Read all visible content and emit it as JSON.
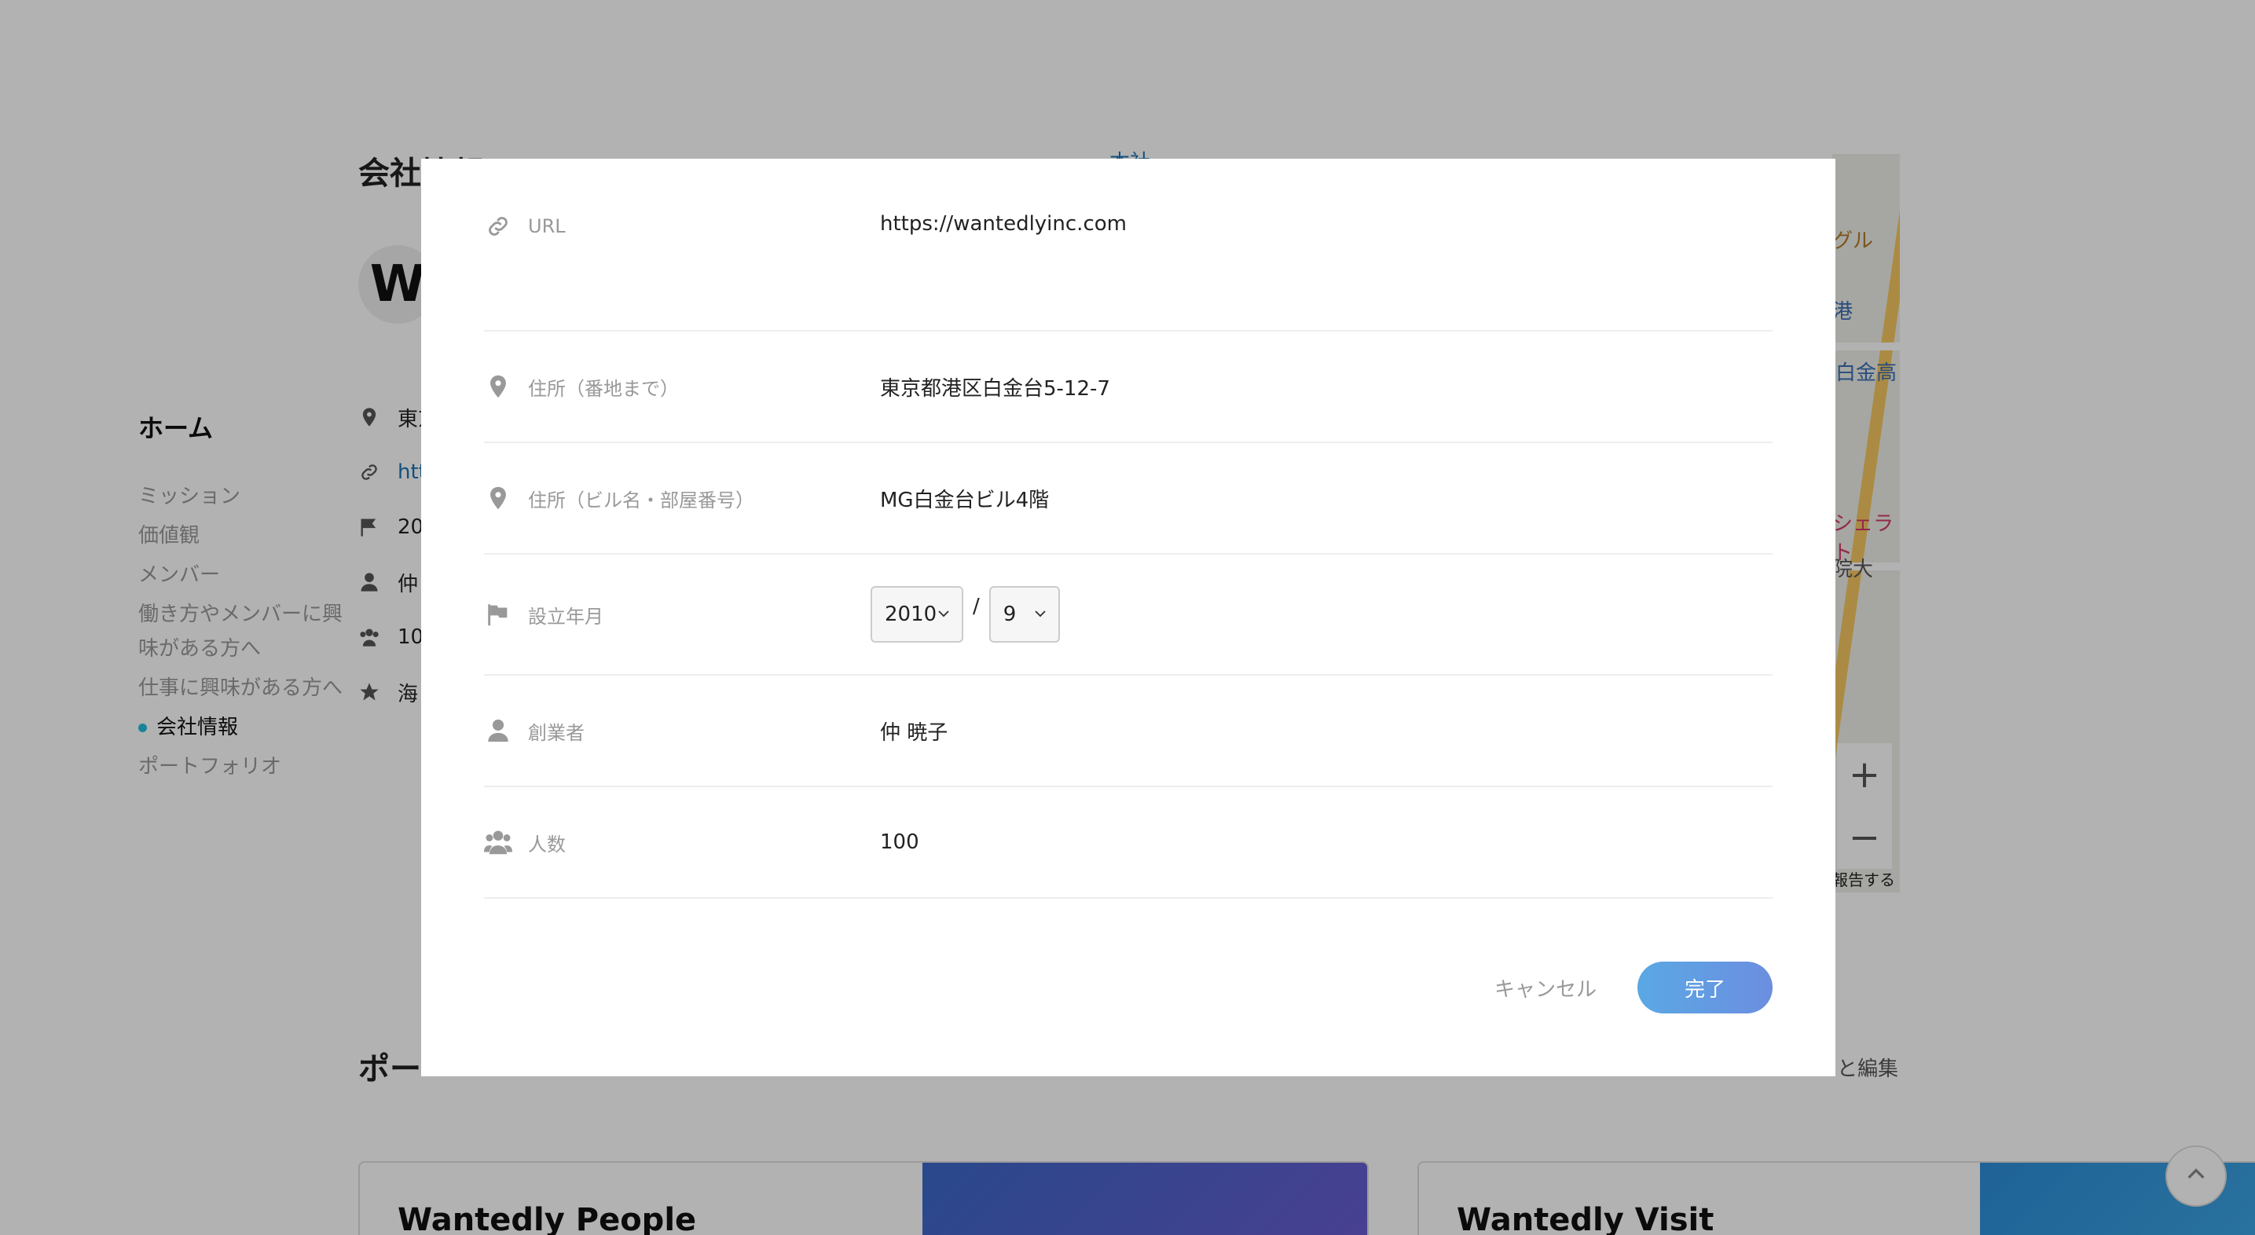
{
  "background": {
    "nav": {
      "home": "ホーム",
      "items": [
        {
          "label": "ミッション"
        },
        {
          "label": "価値観"
        },
        {
          "label": "メンバー"
        },
        {
          "label": "働き方やメンバーに興味がある方へ"
        },
        {
          "label": "仕事に興味がある方へ"
        },
        {
          "label": "会社情報",
          "active": true
        },
        {
          "label": "ポートフォリオ"
        }
      ]
    },
    "section_title": "会社情報",
    "links_text": "本社",
    "info": {
      "address": "東京",
      "url": "htt",
      "year": "20",
      "founder": "仲",
      "members": "10",
      "feature": "海"
    },
    "map_labels": [
      "グル",
      "港",
      "白金高",
      "シェラト",
      "院大",
      "報告する"
    ],
    "section2_title": "ポー",
    "edit_link": "と編集",
    "cards": [
      {
        "title": "Wantedly People"
      },
      {
        "title": "Wantedly Visit"
      }
    ]
  },
  "modal": {
    "fields": {
      "url": {
        "label": "URL",
        "value": "https://wantedlyinc.com",
        "icon": "link-icon"
      },
      "address1": {
        "label": "住所（番地まで）",
        "value": "東京都港区白金台5-12-7",
        "icon": "location-pin-icon"
      },
      "address2": {
        "label": "住所（ビル名・部屋番号）",
        "value": "MG白金台ビル4階",
        "icon": "location-pin-icon"
      },
      "founded": {
        "label": "設立年月",
        "year": "2010",
        "separator": "/",
        "month": "9",
        "icon": "flag-icon"
      },
      "founder": {
        "label": "創業者",
        "value": "仲 暁子",
        "icon": "person-icon"
      },
      "members": {
        "label": "人数",
        "value": "100",
        "icon": "people-icon"
      }
    },
    "cancel_label": "キャンセル",
    "done_label": "完了"
  },
  "colors": {
    "accent": "#5aa8e4",
    "link": "#1a73b5",
    "overlay": "rgba(0,0,0,0.30)"
  }
}
